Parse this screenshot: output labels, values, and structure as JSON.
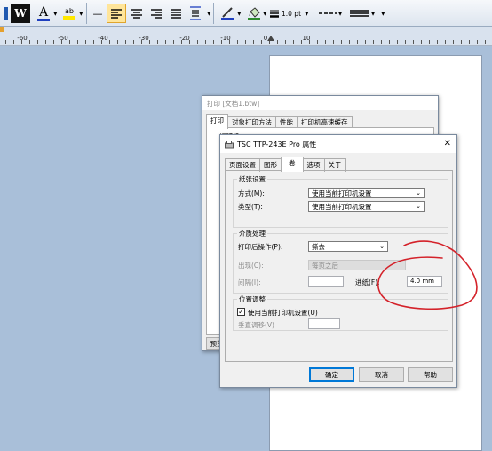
{
  "toolbar": {
    "items": [
      "W",
      "A",
      "ab",
      "—",
      "1.0 pt"
    ]
  },
  "ruler": {
    "labels": [
      "60",
      "50",
      "40",
      "30",
      "20",
      "10",
      "0",
      "10"
    ]
  },
  "back_dialog": {
    "title": "打印 [文档1.btw]",
    "tabs": [
      "打印",
      "对象打印方法",
      "性能",
      "打印机高速缓存"
    ],
    "group_label": "打印机",
    "bottom_button": "预览"
  },
  "props_dialog": {
    "title": "TSC TTP-243E Pro 属性",
    "tabs": [
      "页面设置",
      "图形",
      "卷",
      "选项",
      "关于"
    ],
    "selected_tab": "卷",
    "stock": {
      "title": "纸张设置",
      "method_label": "方式(M):",
      "method_value": "使用当前打印机设置",
      "type_label": "类型(T):",
      "type_value": "使用当前打印机设置"
    },
    "media": {
      "title": "介质处理",
      "post_action_label": "打印后操作(P):",
      "post_action_value": "撕去",
      "occurrence_label": "出现(C):",
      "occurrence_value": "每页之后",
      "interval_label": "间隔(I):",
      "interval_value": "",
      "feed_label": "进纸(F):",
      "feed_value": "4.0 mm"
    },
    "position": {
      "title": "位置调整",
      "checkbox_label": "使用当前打印机设置(U)",
      "checkbox_checked": true,
      "vertical_label": "垂直调移(V)",
      "vertical_value": ""
    },
    "buttons": {
      "ok": "确定",
      "cancel": "取消",
      "help": "帮助"
    },
    "close_glyph": "✕"
  },
  "colors": {
    "annotation": "#d4222a",
    "workspace": "#a9bfd9"
  }
}
